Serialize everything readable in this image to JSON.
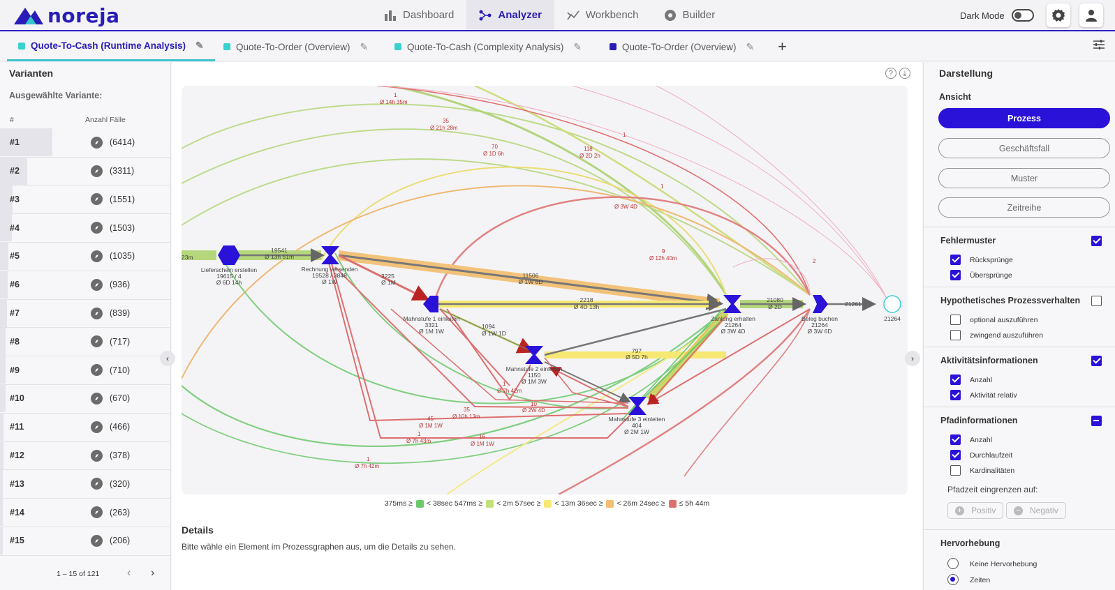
{
  "app": {
    "logo_text": "noreja",
    "dark_mode_label": "Dark Mode"
  },
  "nav": [
    {
      "label": "Dashboard",
      "icon": "bar-chart-icon"
    },
    {
      "label": "Analyzer",
      "icon": "process-icon"
    },
    {
      "label": "Workbench",
      "icon": "workbench-icon"
    },
    {
      "label": "Builder",
      "icon": "builder-icon"
    }
  ],
  "tabs": [
    {
      "label": "Quote-To-Cash (Runtime Analysis)",
      "color": "#39d0d0"
    },
    {
      "label": "Quote-To-Order (Overview)",
      "color": "#39d0d0"
    },
    {
      "label": "Quote-To-Cash (Complexity Analysis)",
      "color": "#39d0d0"
    },
    {
      "label": "Quote-To-Order (Overview)",
      "color": "#2a1db7"
    }
  ],
  "variants": {
    "title": "Varianten",
    "selected_label": "Ausgewählte Variante:",
    "col_num": "#",
    "col_count": "Anzahl Fälle",
    "rows": [
      {
        "num": "#1",
        "count": "(6414)",
        "share": 1.0
      },
      {
        "num": "#2",
        "count": "(3311)",
        "share": 0.52
      },
      {
        "num": "#3",
        "count": "(1551)",
        "share": 0.24
      },
      {
        "num": "#4",
        "count": "(1503)",
        "share": 0.23
      },
      {
        "num": "#5",
        "count": "(1035)",
        "share": 0.16
      },
      {
        "num": "#6",
        "count": "(936)",
        "share": 0.15
      },
      {
        "num": "#7",
        "count": "(839)",
        "share": 0.13
      },
      {
        "num": "#8",
        "count": "(717)",
        "share": 0.11
      },
      {
        "num": "#9",
        "count": "(710)",
        "share": 0.11
      },
      {
        "num": "#10",
        "count": "(670)",
        "share": 0.1
      },
      {
        "num": "#11",
        "count": "(466)",
        "share": 0.07
      },
      {
        "num": "#12",
        "count": "(378)",
        "share": 0.06
      },
      {
        "num": "#13",
        "count": "(320)",
        "share": 0.05
      },
      {
        "num": "#14",
        "count": "(263)",
        "share": 0.04
      },
      {
        "num": "#15",
        "count": "(206)",
        "share": 0.03
      }
    ],
    "pager": "1 – 15 of 121"
  },
  "graph": {
    "nodes": [
      {
        "name": "Lieferschein erstellen",
        "l1": "Lieferschein erstellen",
        "l2": "19615 / 4",
        "l3": "Ø 6D 14h"
      },
      {
        "name": "Rechnung versenden",
        "l1": "Rechnung versenden",
        "l2": "19528 / 3848",
        "l3": "Ø 1W"
      },
      {
        "name": "Mahnstufe 1 einleiten",
        "l1": "Mahnstufe 1 einleiten",
        "l2": "3321",
        "l3": "Ø 1M 1W"
      },
      {
        "name": "Mahnstufe 2 einleiten",
        "l1": "Mahnstufe 2 einleiten",
        "l2": "1150",
        "l3": "Ø 1M 3W"
      },
      {
        "name": "Mahnstufe 3 einleiten",
        "l1": "Mahnstufe 3 einleiten",
        "l2": "404",
        "l3": "Ø 2M 1W"
      },
      {
        "name": "Zahlung erhalten",
        "l1": "Zahlung erhalten",
        "l2": "21264",
        "l3": "Ø 3W 4D"
      },
      {
        "name": "Beleg buchen",
        "l1": "Beleg buchen",
        "l2": "21264",
        "l3": "Ø 3W 6D"
      },
      {
        "name": "End",
        "l1": "",
        "l2": "21264",
        "l3": ""
      }
    ],
    "edge_labels": {
      "e1": "19541",
      "e1t": "Ø 13h 51m",
      "e2": "11506",
      "e2t": "Ø 1W 6D",
      "e3": "2218",
      "e3t": "Ø 4D 13h",
      "e4": "21080",
      "e4t": "Ø 2D",
      "e5": "21261",
      "e6": "797",
      "e6t": "Ø 5D 7h",
      "e7": "3225",
      "e7t": "Ø 1M",
      "e8": "1094",
      "e8t": "Ø 1W 1D",
      "a1": "1",
      "a1t": "Ø 14h 35m",
      "a2": "35",
      "a2t": "Ø 21h 28m",
      "a3": "70",
      "a3t": "Ø 1D 6h",
      "a4": "118",
      "a4t": "Ø 2D 2h",
      "a5": "1",
      "a6": "1",
      "a6t": "Ø 3W 4D",
      "a7": "9",
      "a7t": "Ø 12h 40m",
      "a8": "2",
      "a9": "45",
      "a9t": "Ø 1M 1W",
      "a10": "1",
      "a10t": "Ø 7h 42m",
      "a11": "10",
      "a11t": "Ø 2W 4D",
      "a12": "35",
      "a12t": "Ø 10h 13m",
      "a13": "16",
      "a13t": "Ø 1M 1W",
      "a14": "1",
      "a14t": "Ø 7h 43m",
      "a15": "1",
      "a15t": "Ø 7h 42m"
    },
    "start_label": "23m"
  },
  "legend": {
    "items": [
      {
        "text": "375ms ≥",
        "color": "#6cc96c"
      },
      {
        "text": "< 38sec 547ms ≥",
        "color": "#c3e07a"
      },
      {
        "text": "< 2m 57sec ≥",
        "color": "#f6e873"
      },
      {
        "text": "< 13m 36sec ≥",
        "color": "#f5bd6e"
      },
      {
        "text": "< 26m 24sec ≥",
        "color": "#de6f6f"
      },
      {
        "text": "≤ 5h 44m",
        "color": ""
      }
    ]
  },
  "details": {
    "title": "Details",
    "text": "Bitte wähle ein Element im Prozessgraphen aus, um die Details zu sehen."
  },
  "display": {
    "title": "Darstellung",
    "view_label": "Ansicht",
    "views": [
      "Prozess",
      "Geschäftsfall",
      "Muster",
      "Zeitreihe"
    ],
    "sections": {
      "errors": {
        "title": "Fehlermuster",
        "opts": [
          "Rücksprünge",
          "Übersprünge"
        ]
      },
      "hypo": {
        "title": "Hypothetisches Prozessverhalten",
        "opts": [
          "optional auszuführen",
          "zwingend auszuführen"
        ]
      },
      "activity": {
        "title": "Aktivitätsinformationen",
        "opts": [
          "Anzahl",
          "Aktivität relativ"
        ]
      },
      "path": {
        "title": "Pfadinformationen",
        "opts": [
          "Anzahl",
          "Durchlaufzeit",
          "Kardinalitäten"
        ],
        "restrict_label": "Pfadzeit eingrenzen auf:",
        "positive": "Positiv",
        "negative": "Negativ"
      },
      "highlight": {
        "title": "Hervorhebung",
        "opts": [
          "Keine Hervorhebung",
          "Zeiten"
        ]
      }
    }
  }
}
